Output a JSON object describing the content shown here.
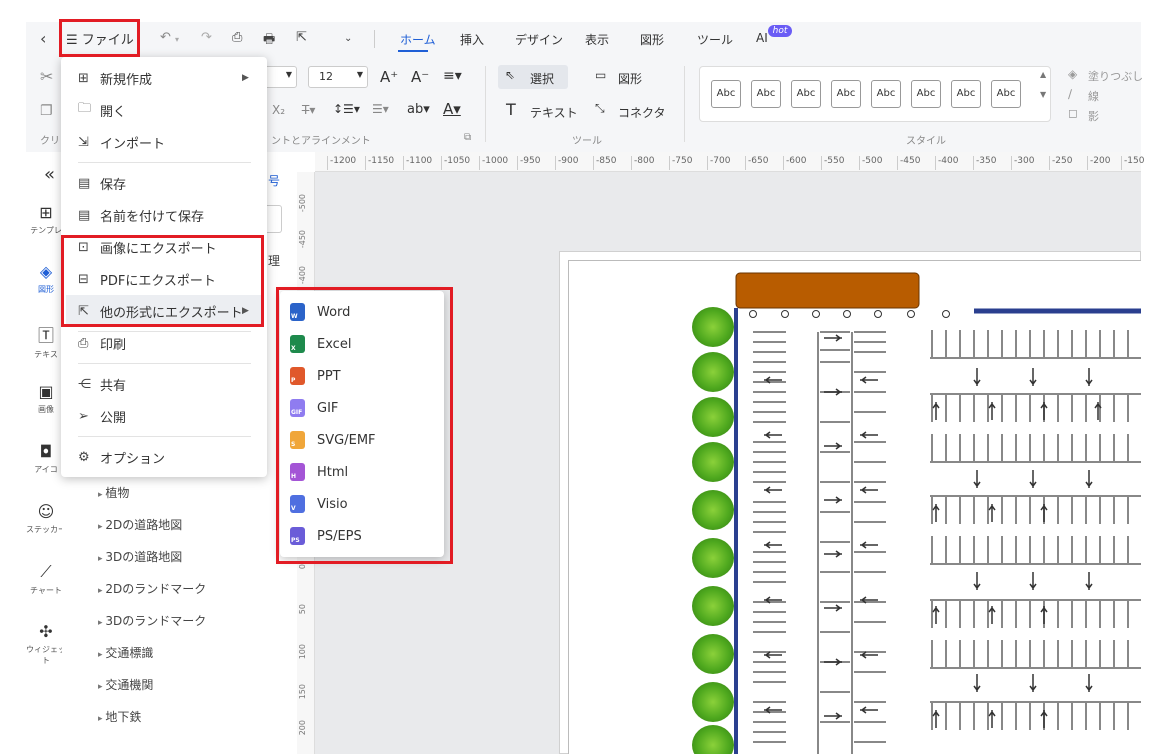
{
  "toolbar": {
    "back_icon": "chevron-left-icon",
    "file_label": "ファイル",
    "tabs": [
      {
        "label": "ホーム",
        "active": true
      },
      {
        "label": "挿入"
      },
      {
        "label": "デザイン"
      },
      {
        "label": "表示"
      },
      {
        "label": "図形"
      },
      {
        "label": "ツール"
      },
      {
        "label": "AI"
      }
    ],
    "ai_badge": "hot"
  },
  "ribbon": {
    "font_size": "12",
    "select_label": "選択",
    "shape_label": "図形",
    "text_label": "テキスト",
    "connector_label": "コネクタ",
    "group_font": "ントとアラインメント",
    "group_tools": "ツール",
    "group_style": "スタイル",
    "clip_label": "クリ",
    "style_sample": "Abc",
    "fill_label": "塗りつぶし",
    "line_label": "線",
    "shadow_label": "影"
  },
  "ruler": {
    "top": [
      "-1200",
      "-1150",
      "-1100",
      "-1050",
      "-1000",
      "-950",
      "-900",
      "-850",
      "-800",
      "-750",
      "-700",
      "-650",
      "-600",
      "-550",
      "-500",
      "-450",
      "-400",
      "-350",
      "-300",
      "-250",
      "-200",
      "-150"
    ],
    "left": [
      "-500",
      "-450",
      "-400",
      "0",
      "50",
      "100",
      "150",
      "200"
    ]
  },
  "sidebar": {
    "collapse_icon": "double-chevron-left-icon",
    "items": [
      {
        "label": "テンプレ",
        "icon": "template-icon"
      },
      {
        "label": "図形",
        "icon": "shapes-icon"
      },
      {
        "label": "テキス",
        "icon": "text-icon"
      },
      {
        "label": "画像",
        "icon": "image-icon"
      },
      {
        "label": "アイコ",
        "icon": "icon-icon"
      },
      {
        "label": "ステッカー",
        "icon": "sticker-icon"
      },
      {
        "label": "チャート",
        "icon": "chart-icon"
      },
      {
        "label": "ウィジェット",
        "icon": "widget-icon"
      }
    ]
  },
  "library": {
    "partial_top": "号",
    "partial_mid": "理",
    "items": [
      "植物",
      "2Dの道路地図",
      "3Dの道路地図",
      "2Dのランドマーク",
      "3Dのランドマーク",
      "交通標識",
      "交通機関",
      "地下鉄"
    ]
  },
  "file_menu": {
    "items": [
      {
        "label": "新規作成",
        "icon": "plus-square-icon",
        "submenu": true
      },
      {
        "label": "開く",
        "icon": "folder-icon"
      },
      {
        "label": "インポート",
        "icon": "import-icon"
      },
      {
        "label": "保存",
        "icon": "save-icon"
      },
      {
        "label": "名前を付けて保存",
        "icon": "save-as-icon"
      },
      {
        "label": "画像にエクスポート",
        "icon": "image-export-icon"
      },
      {
        "label": "PDFにエクスポート",
        "icon": "pdf-export-icon"
      },
      {
        "label": "他の形式にエクスポート",
        "icon": "export-other-icon",
        "submenu": true
      },
      {
        "label": "印刷",
        "icon": "print-icon"
      },
      {
        "label": "共有",
        "icon": "share-icon"
      },
      {
        "label": "公開",
        "icon": "publish-icon"
      },
      {
        "label": "オプション",
        "icon": "gear-icon"
      }
    ]
  },
  "export_submenu": {
    "items": [
      {
        "label": "Word",
        "color": "#2b63c9",
        "badge": "W"
      },
      {
        "label": "Excel",
        "color": "#1e8a4c",
        "badge": "X"
      },
      {
        "label": "PPT",
        "color": "#e0582b",
        "badge": "P"
      },
      {
        "label": "GIF",
        "color": "#8f7cf0",
        "badge": "GIF"
      },
      {
        "label": "SVG/EMF",
        "color": "#f0a63a",
        "badge": "S"
      },
      {
        "label": "Html",
        "color": "#a455d6",
        "badge": "H"
      },
      {
        "label": "Visio",
        "color": "#4f6fe0",
        "badge": "V"
      },
      {
        "label": "PS/EPS",
        "color": "#6a5cd8",
        "badge": "PS"
      }
    ]
  },
  "colors": {
    "accent": "#1f5fd6",
    "highlight_box": "#e21c24",
    "building": "#b85c00",
    "wall": "#2a3f8f"
  }
}
